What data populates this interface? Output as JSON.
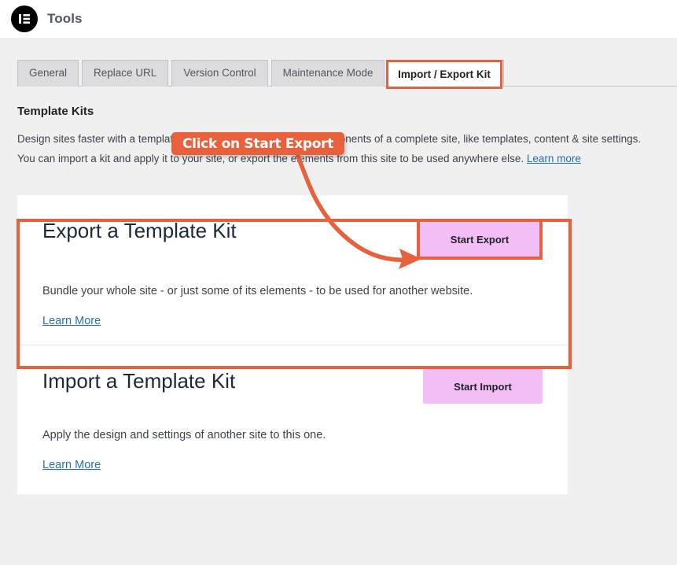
{
  "header": {
    "logo_icon": "elementor-logo-icon",
    "title": "Tools"
  },
  "tabs": [
    {
      "label": "General",
      "active": false
    },
    {
      "label": "Replace URL",
      "active": false
    },
    {
      "label": "Version Control",
      "active": false
    },
    {
      "label": "Maintenance Mode",
      "active": false
    },
    {
      "label": "Import / Export Kit",
      "active": true
    }
  ],
  "main": {
    "section_title": "Template Kits",
    "intro_line1": "Design sites faster with a template kit that contains some or all components of a complete site, like templates, content & site settings.",
    "intro_line2": "You can import a kit and apply it to your site, or export the elements from this site to be used anywhere else.",
    "intro_link": "Learn more"
  },
  "export_card": {
    "title": "Export a Template Kit",
    "button_label": "Start Export",
    "description": "Bundle your whole site - or just some of its elements - to be used for another website.",
    "link_label": "Learn More"
  },
  "import_card": {
    "title": "Import a Template Kit",
    "button_label": "Start Import",
    "description": "Apply the design and settings of another site to this one.",
    "link_label": "Learn More"
  },
  "annotations": {
    "callout_text": "Click on Start Export",
    "arrow_icon": "curved-arrow-icon",
    "highlight_color": "#e8603c",
    "callout_bg": "#e8603c",
    "callout_text_color": "#ffffff"
  },
  "colors": {
    "page_bg": "#f0f0f1",
    "card_bg": "#ffffff",
    "button_bg": "#f3bdf5",
    "link": "#2271b1",
    "accent": "#e8603c"
  }
}
